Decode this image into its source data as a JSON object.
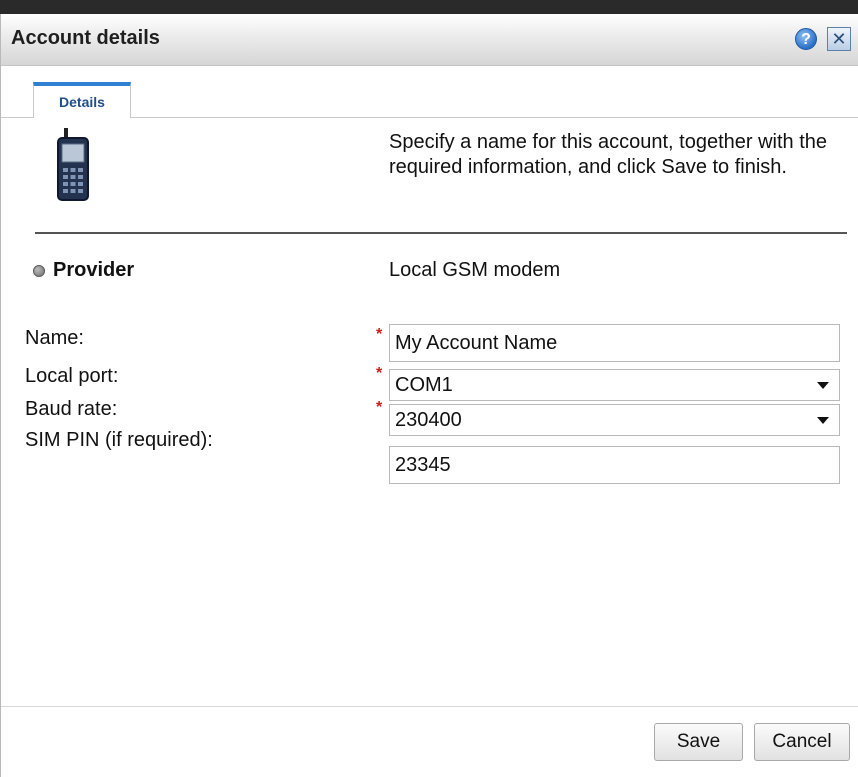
{
  "dialog": {
    "title": "Account details",
    "help_icon": "help-icon",
    "close_icon": "close-icon",
    "tabs": [
      {
        "label": "Details",
        "active": true
      }
    ]
  },
  "details": {
    "icon": "mobile-phone-icon",
    "description": "Specify a name for this account, together with the required information, and click Save to finish.",
    "provider_label": "Provider",
    "provider_value": "Local GSM modem"
  },
  "form": {
    "fields": [
      {
        "label": "Name:",
        "value": "My Account Name",
        "required": true,
        "type": "text"
      },
      {
        "label": "Local port:",
        "value": "COM1",
        "required": true,
        "type": "select"
      },
      {
        "label": "Baud rate:",
        "value": "230400",
        "required": true,
        "type": "select"
      },
      {
        "label": "SIM PIN (if required):",
        "value": "23345",
        "required": false,
        "type": "text"
      }
    ],
    "required_marker": "*"
  },
  "footer": {
    "save_label": "Save",
    "cancel_label": "Cancel"
  },
  "colors": {
    "accent": "#2f7fd3",
    "required": "#cc1b1b"
  }
}
